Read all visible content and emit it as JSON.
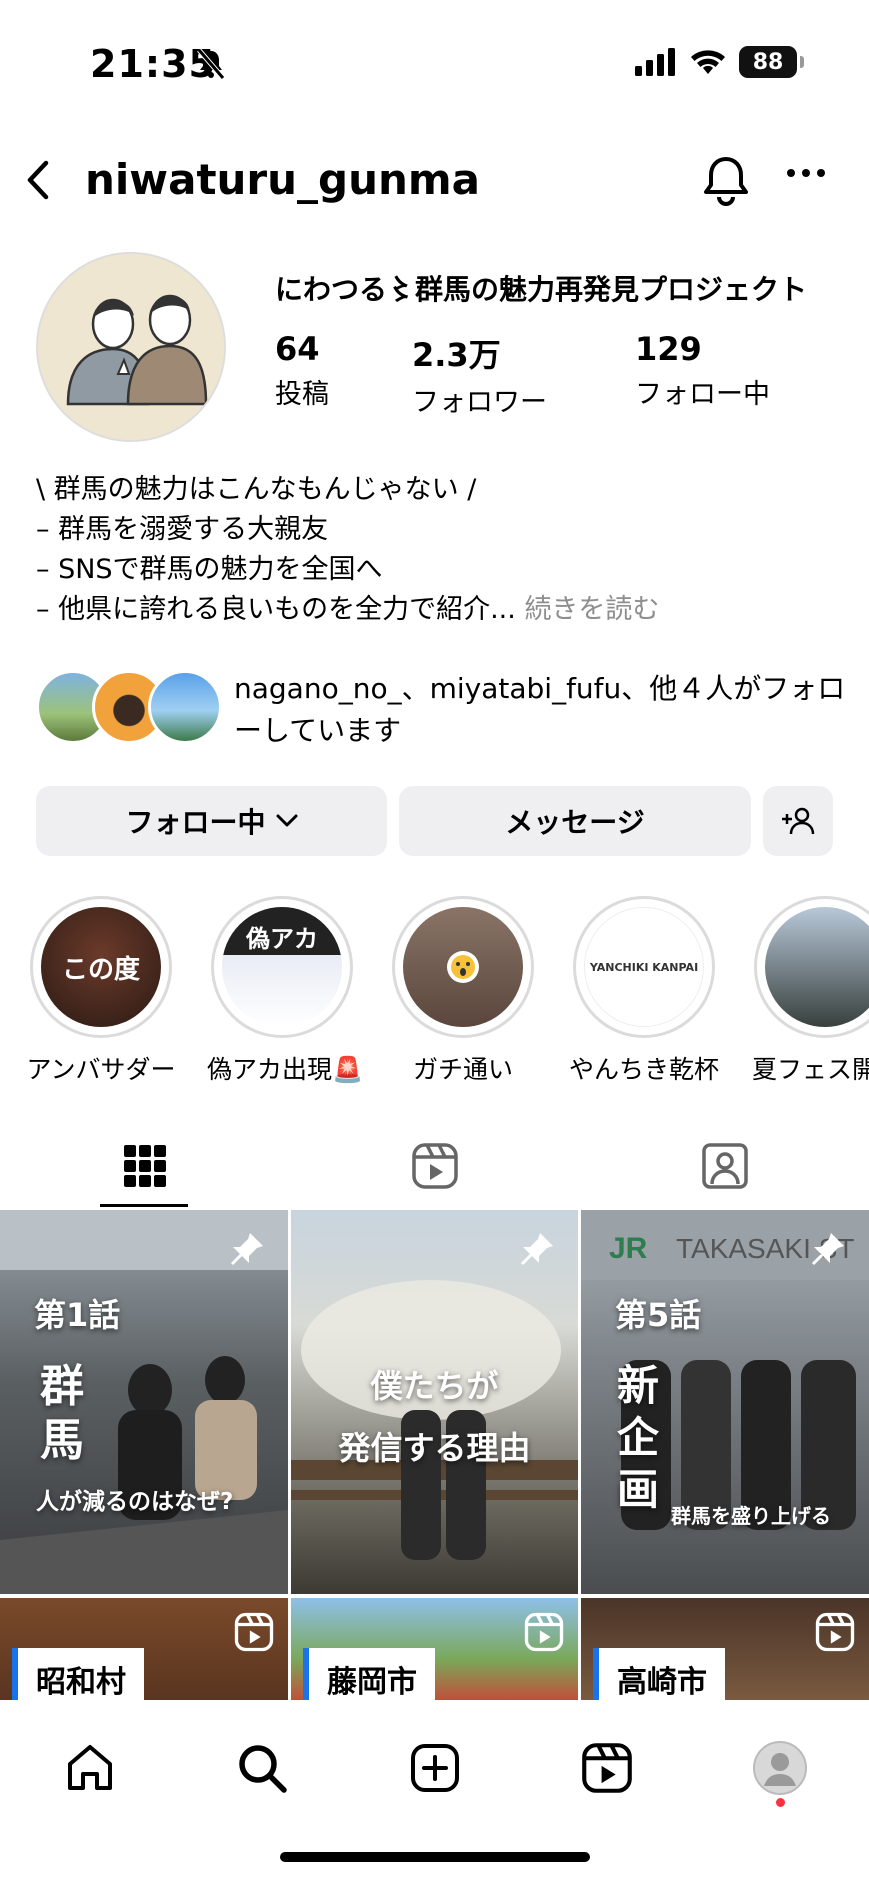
{
  "status_bar": {
    "time": "21:35",
    "battery": "88"
  },
  "header": {
    "username": "niwaturu_gunma"
  },
  "profile": {
    "display_name": "にわつる〻群馬の魅力再発見プロジェクト",
    "stats": [
      {
        "value": "64",
        "label": "投稿"
      },
      {
        "value": "2.3万",
        "label": "フォロワー"
      },
      {
        "value": "129",
        "label": "フォロー中"
      }
    ],
    "bio": [
      "\\ 群馬の魅力はこんなもんじゃない /",
      "– 群馬を溺愛する大親友",
      "– SNSで群馬の魅力を全国へ",
      "– 他県に誇れる良いものを全力で紹介..."
    ],
    "bio_more": "続きを読む",
    "mutual_followers": "nagano_no_、miyatabi_fufu、他４人がフォローしています"
  },
  "actions": {
    "following": "フォロー中",
    "message": "メッセージ"
  },
  "highlights": [
    {
      "label": "アンバサダー",
      "cover_text": "この度"
    },
    {
      "label": "偽アカ出現🚨",
      "cover_text": "偽アカ"
    },
    {
      "label": "ガチ通い",
      "cover_text": ""
    },
    {
      "label": "やんちき乾杯",
      "cover_text": "YANCHIKI KANPAI"
    },
    {
      "label": "夏フェス開",
      "cover_text": ""
    }
  ],
  "grid": {
    "posts": [
      {
        "top": "第1話",
        "big": "群\n馬",
        "sub": "人が減るのはなぜ?"
      },
      {
        "top": "",
        "big": "僕たちが\n発信する理由",
        "sub": ""
      },
      {
        "top": "第5話",
        "big": "新\n企\n画",
        "sub": "群馬を盛り上げる"
      }
    ],
    "reels": [
      {
        "place": "昭和村"
      },
      {
        "place": "藤岡市"
      },
      {
        "place": "高崎市"
      }
    ]
  },
  "colors": {
    "button_bg": "#efeff2",
    "notif_dot": "#ff3040",
    "muted_text": "#8e8e8e"
  }
}
